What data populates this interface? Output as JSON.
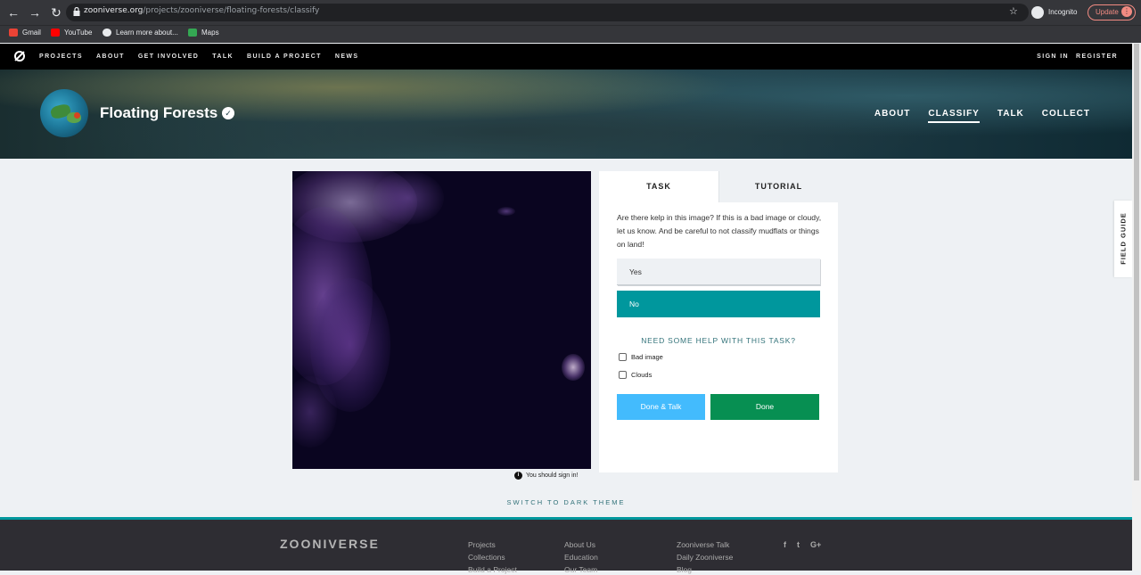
{
  "browser": {
    "url_host": "zooniverse.org",
    "url_path": "/projects/zooniverse/floating-forests/classify",
    "incognito_label": "Incognito",
    "update_label": "Update",
    "bookmarks": [
      {
        "label": "Gmail",
        "icon": "gmail-icon",
        "color": "#ea4335"
      },
      {
        "label": "YouTube",
        "icon": "youtube-icon",
        "color": "#ff0000"
      },
      {
        "label": "Learn more about...",
        "icon": "globe-icon",
        "color": "#e8eaed"
      },
      {
        "label": "Maps",
        "icon": "maps-icon",
        "color": "#34a853"
      }
    ]
  },
  "site_nav": {
    "links": [
      "PROJECTS",
      "ABOUT",
      "GET INVOLVED",
      "TALK",
      "BUILD A PROJECT",
      "NEWS"
    ],
    "sign_in": "SIGN IN",
    "register": "REGISTER"
  },
  "project": {
    "title": "Floating Forests",
    "links": [
      "ABOUT",
      "CLASSIFY",
      "TALK",
      "COLLECT"
    ],
    "active_link": "CLASSIFY"
  },
  "classifier": {
    "sign_in_note": "You should sign in!",
    "tabs": [
      "TASK",
      "TUTORIAL"
    ],
    "question": "Are there kelp in this image? If this is a bad image or cloudy, let us know. And be careful to not classify mudflats or things on land!",
    "answers": [
      "Yes",
      "No"
    ],
    "selected_answer": "No",
    "help_link": "NEED SOME HELP WITH THIS TASK?",
    "checkboxes": [
      "Bad image",
      "Clouds"
    ],
    "done_talk_label": "Done & Talk",
    "done_label": "Done"
  },
  "field_guide_label": "FIELD GUIDE",
  "dark_theme_label": "SWITCH TO DARK THEME",
  "footer": {
    "logo": "ZOONIVERSE",
    "col1": [
      "Projects",
      "Collections",
      "Build a Project"
    ],
    "col2": [
      "About Us",
      "Education",
      "Our Team"
    ],
    "col3": [
      "Zooniverse Talk",
      "Daily Zooniverse",
      "Blog"
    ],
    "social": [
      "f",
      "t",
      "G+"
    ]
  },
  "colors": {
    "accent_teal": "#00979d",
    "done_green": "#078f52",
    "done_talk_blue": "#43bbfd"
  }
}
